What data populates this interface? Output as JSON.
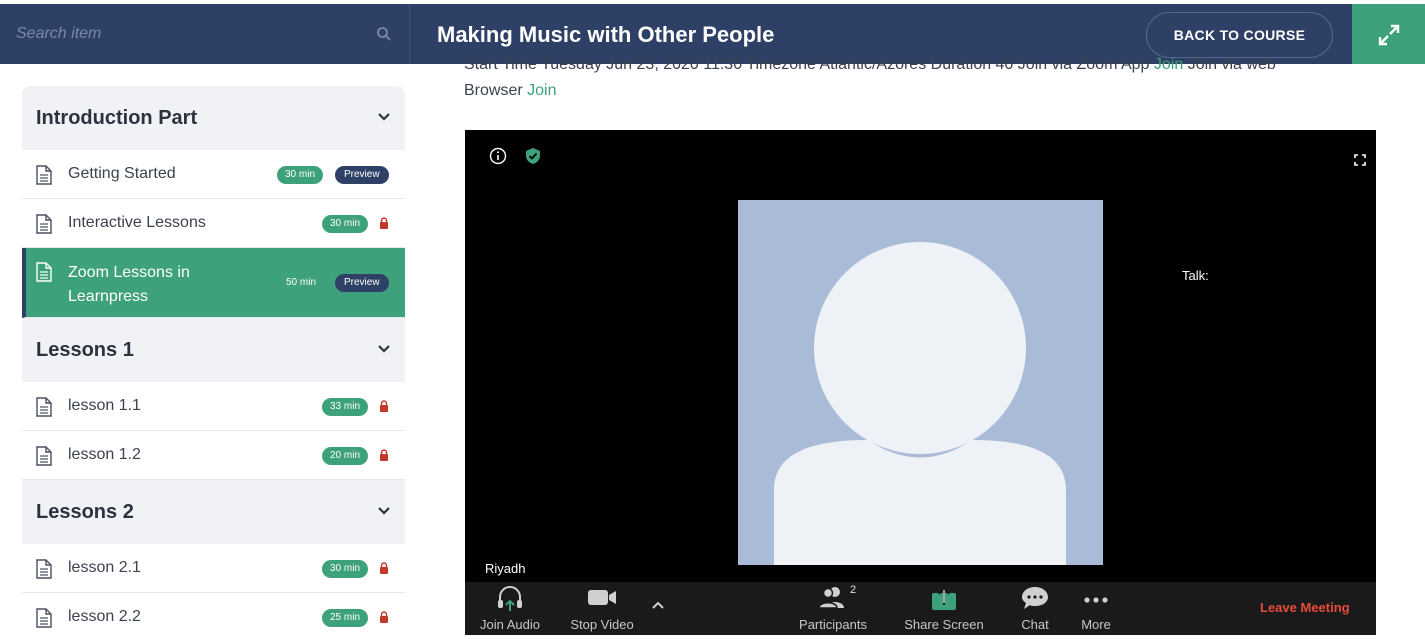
{
  "search": {
    "placeholder": "Search item"
  },
  "header": {
    "title": "Making Music with Other People",
    "back_label": "BACK TO COURSE"
  },
  "sections": [
    {
      "title": "Introduction Part",
      "lessons": [
        {
          "title": "Getting Started",
          "duration": "30 min",
          "preview": "Preview"
        },
        {
          "title": "Interactive Lessons",
          "duration": "30 min"
        },
        {
          "title": "Zoom Lessons in Learnpress",
          "duration": "50 min",
          "preview": "Preview",
          "active": true
        }
      ]
    },
    {
      "title": "Lessons 1",
      "lessons": [
        {
          "title": "lesson 1.1",
          "duration": "33 min"
        },
        {
          "title": "lesson 1.2",
          "duration": "20 min"
        }
      ]
    },
    {
      "title": "Lessons 2",
      "lessons": [
        {
          "title": "lesson 2.1",
          "duration": "30 min"
        },
        {
          "title": "lesson 2.2",
          "duration": "25 min"
        }
      ]
    }
  ],
  "meeting_info": {
    "line1": "Start Time Tuesday Jun 23, 2020 11:30 Timezone Atlantic/Azores Duration 40 Join via Zoom App",
    "join_app": "Join",
    "line1_end": "Join via web",
    "line2_prefix": "Browser",
    "join_web": "Join"
  },
  "video": {
    "talk_label": "Talk:",
    "speaker_name": "Riyadh",
    "toolbar": {
      "join_audio": "Join Audio",
      "stop_video": "Stop Video",
      "participants": "Participants",
      "participants_count": "2",
      "share_screen": "Share Screen",
      "chat": "Chat",
      "more": "More",
      "leave": "Leave Meeting"
    }
  },
  "colors": {
    "header": "#2f4066",
    "accent": "#3da17b",
    "leave": "#e74c3c"
  },
  "icons": [
    "search-icon",
    "expand-icon",
    "chevron-down-icon",
    "document-icon",
    "lock-icon",
    "info-icon",
    "shield-icon",
    "fullscreen-icon",
    "headphones-icon",
    "camera-icon",
    "participants-icon",
    "share-screen-icon",
    "chat-icon",
    "more-icon"
  ]
}
